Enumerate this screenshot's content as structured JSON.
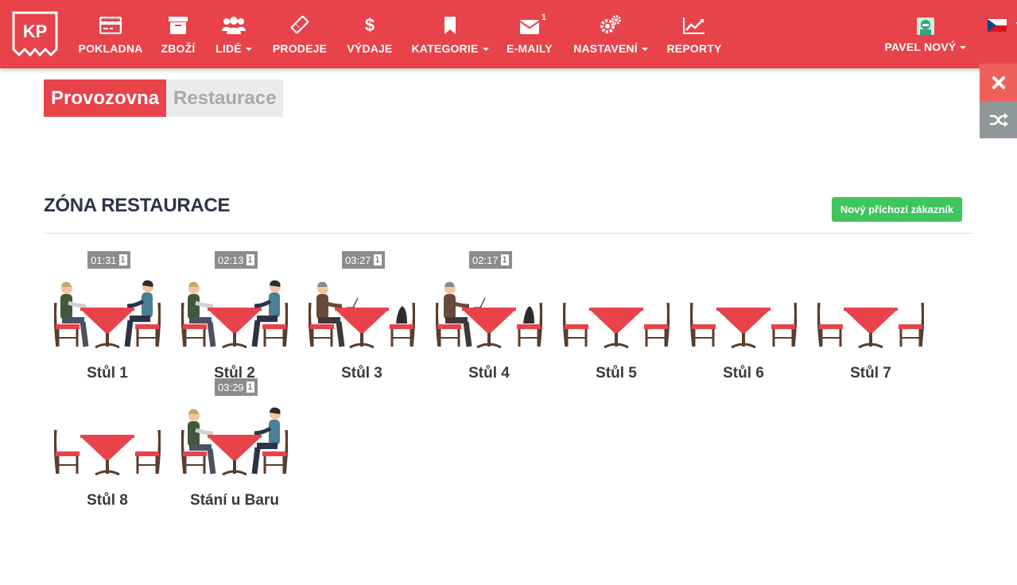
{
  "logo": {
    "text": "KP"
  },
  "nav": [
    {
      "id": "pokladna",
      "label": "POKLADNA",
      "icon": "credit-card-icon",
      "caret": false,
      "badge": ""
    },
    {
      "id": "zbozi",
      "label": "ZBOŽÍ",
      "icon": "archive-box-icon",
      "caret": false,
      "badge": ""
    },
    {
      "id": "lide",
      "label": "LIDÉ",
      "icon": "users-icon",
      "caret": true,
      "badge": ""
    },
    {
      "id": "prodeje",
      "label": "PRODEJE",
      "icon": "ticket-icon",
      "caret": false,
      "badge": ""
    },
    {
      "id": "vydaje",
      "label": "VÝDAJE",
      "icon": "dollar-icon",
      "caret": false,
      "badge": ""
    },
    {
      "id": "kategorie",
      "label": "KATEGORIE",
      "icon": "bookmark-icon",
      "caret": true,
      "badge": ""
    },
    {
      "id": "emaily",
      "label": "E-MAILY",
      "icon": "envelope-icon",
      "caret": false,
      "badge": "1"
    },
    {
      "id": "nastaveni",
      "label": "NASTAVENÍ",
      "icon": "gears-icon",
      "caret": true,
      "badge": ""
    },
    {
      "id": "reporty",
      "label": "REPORTY",
      "icon": "line-chart-icon",
      "caret": false,
      "badge": ""
    }
  ],
  "user": {
    "name": "PAVEL NOVÝ",
    "icon": "user-avatar-icon"
  },
  "language": {
    "icon": "czech-flag-icon"
  },
  "side_buttons": {
    "close_icon": "close-icon",
    "shuffle_icon": "shuffle-icon",
    "close_color": "#f0605a",
    "shuffle_color": "#8e9898"
  },
  "tabs": [
    {
      "label": "Provozovna",
      "active": true
    },
    {
      "label": "Restaurace",
      "active": false
    }
  ],
  "zone": {
    "title": "ZÓNA RESTAURACE",
    "new_customer_button": "Nový příchozí zákazník"
  },
  "tables": [
    {
      "name": "Stůl 1",
      "timer": "01:31",
      "count": "1",
      "occupants": "two-people"
    },
    {
      "name": "Stůl 2",
      "timer": "02:13",
      "count": "1",
      "occupants": "two-people"
    },
    {
      "name": "Stůl 3",
      "timer": "03:27",
      "count": "1",
      "occupants": "one-person-laptop"
    },
    {
      "name": "Stůl 4",
      "timer": "02:17",
      "count": "1",
      "occupants": "one-person-laptop"
    },
    {
      "name": "Stůl 5",
      "timer": "",
      "count": "",
      "occupants": "empty"
    },
    {
      "name": "Stůl 6",
      "timer": "",
      "count": "",
      "occupants": "empty"
    },
    {
      "name": "Stůl 7",
      "timer": "",
      "count": "",
      "occupants": "empty"
    },
    {
      "name": "Stůl 8",
      "timer": "",
      "count": "",
      "occupants": "empty"
    },
    {
      "name": "Stání u Baru",
      "timer": "03:29",
      "count": "1",
      "occupants": "two-people"
    }
  ],
  "colors": {
    "brand_red": "#e8424a",
    "success_green": "#3fc45e",
    "title_dark": "#2c3347"
  }
}
